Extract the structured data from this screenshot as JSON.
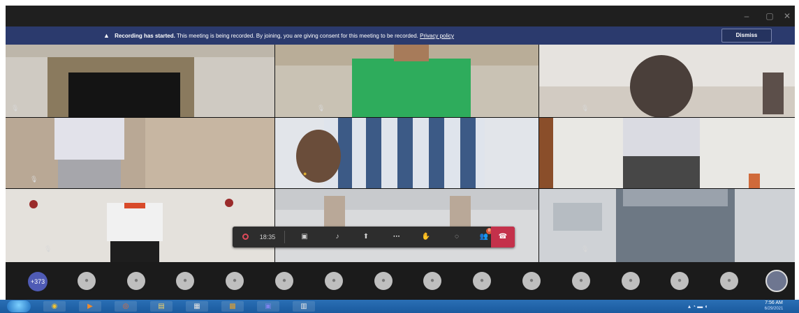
{
  "window": {
    "controls": {
      "minimize": "–",
      "maximize": "▢",
      "close": "✕"
    }
  },
  "banner": {
    "title": "Recording has started.",
    "message": "This meeting is being recorded. By joining, you are giving consent for this meeting to be recorded.",
    "link": "Privacy policy",
    "dismiss": "Dismiss",
    "icon": "warning-icon"
  },
  "call_controls": {
    "recording_time": "18:35",
    "icons": [
      "record-icon",
      "camera-off-icon",
      "mic-icon",
      "share-icon",
      "more-icon",
      "raise-hand-icon",
      "chat-icon",
      "people-icon",
      "hang-up-icon"
    ],
    "people_badge": "8"
  },
  "participants": {
    "more_count": "+373",
    "avatar_count": 14
  },
  "taskbar": {
    "time": "7:56 AM",
    "date": "6/29/2021"
  },
  "colors": {
    "banner": "#2b3a6d",
    "hangup": "#c4314b",
    "more_count": "#4f5bb5",
    "taskbar": "#1a5a9e"
  }
}
